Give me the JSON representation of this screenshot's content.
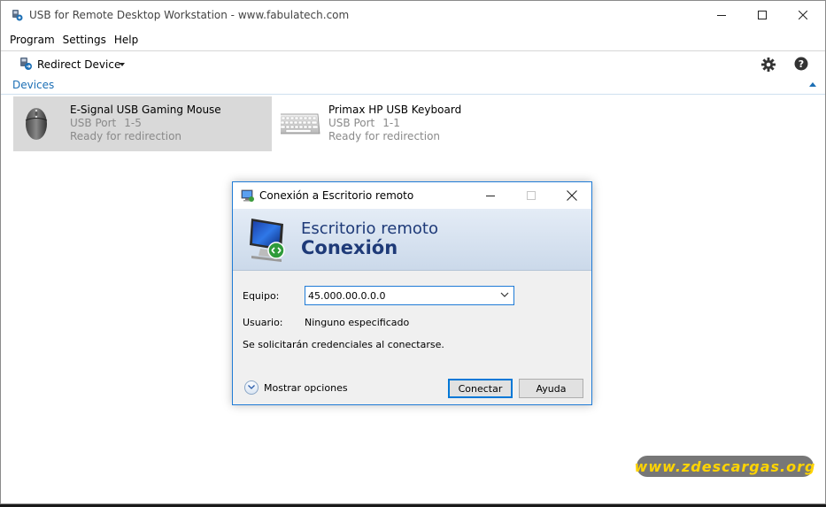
{
  "window": {
    "title": "USB for Remote Desktop Workstation - www.fabulatech.com"
  },
  "menu": {
    "items": [
      "Program",
      "Settings",
      "Help"
    ]
  },
  "toolbar": {
    "redirect_label": "Redirect Device"
  },
  "devices": {
    "header": "Devices",
    "items": [
      {
        "name": "E-Signal USB Gaming Mouse",
        "port_label": "USB Port",
        "port": "1-5",
        "status": "Ready for redirection",
        "icon": "mouse-icon",
        "selected": true
      },
      {
        "name": "Primax HP USB Keyboard",
        "port_label": "USB Port",
        "port": "1-1",
        "status": "Ready for redirection",
        "icon": "keyboard-icon",
        "selected": false
      }
    ]
  },
  "dialog": {
    "title": "Conexión a Escritorio remoto",
    "banner_line1": "Escritorio remoto",
    "banner_line2": "Conexión",
    "computer_label": "Equipo:",
    "computer_value": "45.000.00.0.0.0",
    "user_label": "Usuario:",
    "user_value": "Ninguno especificado",
    "credentials_note": "Se solicitarán credenciales al conectarse.",
    "show_options": "Mostrar opciones",
    "connect_label": "Conectar",
    "help_label": "Ayuda"
  },
  "watermark": "www.zdescargas.org",
  "colors": {
    "accent": "#1c6fb5",
    "banner_text": "#1e3a78",
    "selected_bg": "#d9d9d9",
    "watermark_text": "#ffd400"
  }
}
